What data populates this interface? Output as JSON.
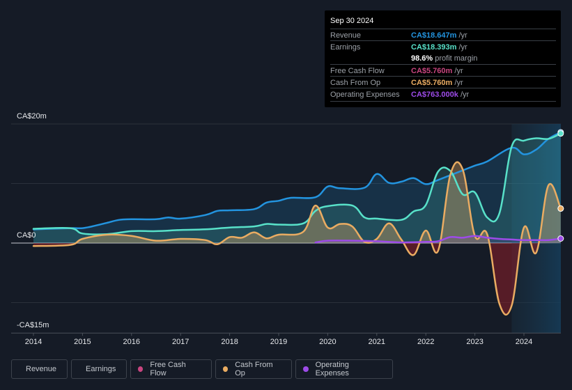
{
  "tooltip": {
    "date": "Sep 30 2024",
    "rows": [
      {
        "label": "Revenue",
        "value": "CA$18.647m",
        "unit": " /yr",
        "color": "#2394df"
      },
      {
        "label": "Earnings",
        "value": "CA$18.393m",
        "unit": " /yr",
        "color": "#58e1c9"
      },
      {
        "label": "",
        "value": "98.6%",
        "unit": " profit margin",
        "color": "#ffffff"
      },
      {
        "label": "Free Cash Flow",
        "value": "CA$5.760m",
        "unit": " /yr",
        "color": "#c8457f"
      },
      {
        "label": "Cash From Op",
        "value": "CA$5.760m",
        "unit": " /yr",
        "color": "#eaac62"
      },
      {
        "label": "Operating Expenses",
        "value": "CA$763.000k",
        "unit": " /yr",
        "color": "#9d4be8"
      }
    ]
  },
  "legend": [
    {
      "label": "Revenue",
      "color": "#2394df"
    },
    {
      "label": "Earnings",
      "color": "#58e1c9"
    },
    {
      "label": "Free Cash Flow",
      "color": "#c8457f"
    },
    {
      "label": "Cash From Op",
      "color": "#eaac62"
    },
    {
      "label": "Operating Expenses",
      "color": "#9d4be8"
    }
  ],
  "chart_data": {
    "type": "line",
    "title": "",
    "xlabel": "",
    "ylabel": "",
    "currency": "CA$",
    "ylim": [
      -15,
      20
    ],
    "y_ticks": [
      {
        "value": 20,
        "label": "CA$20m"
      },
      {
        "value": 0,
        "label": "CA$0"
      },
      {
        "value": -15,
        "label": "-CA$15m"
      }
    ],
    "gridlines": [
      20,
      10,
      0,
      -10
    ],
    "x_range": [
      2013.75,
      2024.85
    ],
    "x_ticks": [
      "2014",
      "2015",
      "2016",
      "2017",
      "2018",
      "2019",
      "2020",
      "2021",
      "2022",
      "2023",
      "2024"
    ],
    "forecast_shade_start": 2023.75,
    "grid": true,
    "legend_position": "bottom",
    "series": [
      {
        "name": "Revenue",
        "color": "#2394df",
        "x": [
          2014.0,
          2014.75,
          2015.0,
          2015.25,
          2015.5,
          2015.75,
          2016.0,
          2016.5,
          2016.75,
          2017.0,
          2017.5,
          2017.75,
          2018.0,
          2018.5,
          2018.75,
          2019.0,
          2019.25,
          2019.75,
          2020.0,
          2020.25,
          2020.75,
          2021.0,
          2021.25,
          2021.5,
          2021.75,
          2022.0,
          2022.25,
          2022.75,
          2023.0,
          2023.25,
          2023.75,
          2024.0,
          2024.25,
          2024.5,
          2024.75
        ],
        "values": [
          2.3,
          2.5,
          2.5,
          2.9,
          3.4,
          3.9,
          4.0,
          4.0,
          4.3,
          4.1,
          4.7,
          5.4,
          5.5,
          5.7,
          6.8,
          7.1,
          7.6,
          7.7,
          9.5,
          9.2,
          9.3,
          11.6,
          10.1,
          10.3,
          10.9,
          9.9,
          10.6,
          12.2,
          13.0,
          13.7,
          16.0,
          14.9,
          15.7,
          17.5,
          18.6
        ]
      },
      {
        "name": "Earnings",
        "color": "#58e1c9",
        "x": [
          2014.0,
          2014.75,
          2015.0,
          2015.5,
          2016.0,
          2016.5,
          2017.0,
          2017.5,
          2018.0,
          2018.5,
          2018.75,
          2019.0,
          2019.5,
          2019.75,
          2020.0,
          2020.5,
          2020.75,
          2021.0,
          2021.5,
          2021.75,
          2022.0,
          2022.25,
          2022.5,
          2022.75,
          2023.0,
          2023.25,
          2023.5,
          2023.75,
          2024.0,
          2024.25,
          2024.5,
          2024.75
        ],
        "values": [
          2.4,
          2.5,
          1.6,
          1.5,
          2.0,
          2.0,
          2.2,
          2.3,
          2.6,
          2.8,
          3.2,
          3.1,
          3.3,
          5.4,
          6.2,
          6.3,
          4.3,
          4.1,
          3.9,
          5.3,
          6.4,
          12.0,
          12.1,
          8.2,
          8.5,
          4.3,
          5.0,
          16.2,
          17.2,
          17.6,
          17.5,
          18.4
        ]
      },
      {
        "name": "Free Cash Flow",
        "color": "#c8457f",
        "x": [
          2014.0,
          2014.75,
          2015.0,
          2015.5,
          2016.0,
          2016.5,
          2017.0,
          2017.5,
          2017.75,
          2018.0,
          2018.25,
          2018.5,
          2018.75,
          2019.0,
          2019.5,
          2019.75,
          2020.0,
          2020.25,
          2020.5,
          2020.75,
          2021.0,
          2021.25,
          2021.5,
          2021.75,
          2022.0,
          2022.25,
          2022.5,
          2022.75,
          2023.0,
          2023.25,
          2023.5,
          2023.75,
          2024.0,
          2024.25,
          2024.5,
          2024.75
        ],
        "values": [
          -0.5,
          -0.3,
          0.7,
          1.4,
          1.2,
          0.4,
          0.7,
          0.5,
          -0.2,
          1.0,
          0.9,
          1.8,
          0.8,
          1.4,
          1.9,
          6.3,
          2.6,
          3.2,
          2.8,
          0.2,
          0.7,
          3.3,
          0.6,
          -2.0,
          2.1,
          -1.3,
          11.5,
          12.4,
          1.2,
          1.5,
          -10.2,
          -10.5,
          2.6,
          -1.6,
          9.7,
          5.8
        ]
      },
      {
        "name": "Cash From Op",
        "color": "#eaac62",
        "x": [
          2014.0,
          2014.75,
          2015.0,
          2015.5,
          2016.0,
          2016.5,
          2017.0,
          2017.5,
          2017.75,
          2018.0,
          2018.25,
          2018.5,
          2018.75,
          2019.0,
          2019.5,
          2019.75,
          2020.0,
          2020.25,
          2020.5,
          2020.75,
          2021.0,
          2021.25,
          2021.5,
          2021.75,
          2022.0,
          2022.25,
          2022.5,
          2022.75,
          2023.0,
          2023.25,
          2023.5,
          2023.75,
          2024.0,
          2024.25,
          2024.5,
          2024.75
        ],
        "values": [
          -0.5,
          -0.3,
          0.7,
          1.4,
          1.2,
          0.4,
          0.7,
          0.5,
          -0.2,
          1.0,
          0.9,
          1.8,
          0.8,
          1.4,
          1.9,
          6.3,
          2.6,
          3.2,
          2.8,
          0.2,
          0.7,
          3.3,
          0.6,
          -2.0,
          2.1,
          -1.3,
          11.5,
          12.4,
          1.2,
          1.5,
          -10.2,
          -10.5,
          2.6,
          -1.6,
          9.7,
          5.8
        ]
      },
      {
        "name": "Operating Expenses",
        "color": "#9d4be8",
        "x": [
          2019.75,
          2020.0,
          2020.5,
          2021.0,
          2021.5,
          2022.0,
          2022.25,
          2022.5,
          2022.75,
          2023.0,
          2023.25,
          2023.5,
          2023.75,
          2024.0,
          2024.25,
          2024.5,
          2024.75
        ],
        "values": [
          0.1,
          0.4,
          0.4,
          0.3,
          0.1,
          0.2,
          0.3,
          1.0,
          0.9,
          1.2,
          0.9,
          0.7,
          0.6,
          0.5,
          0.5,
          0.5,
          0.76
        ]
      }
    ]
  }
}
